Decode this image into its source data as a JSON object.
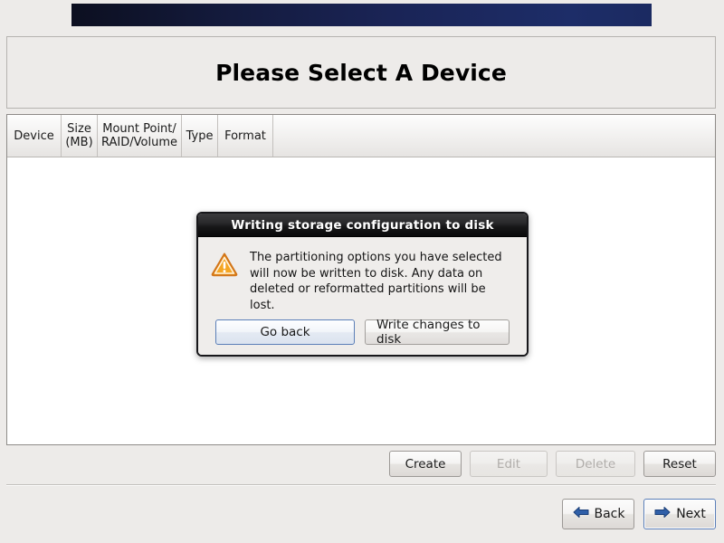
{
  "banner": {
    "gradient_start": "#0c0f20",
    "gradient_end": "#1d2d68"
  },
  "header": {
    "title": "Please Select A Device"
  },
  "device_table": {
    "columns": [
      {
        "label": "Device"
      },
      {
        "label": "Size\n(MB)"
      },
      {
        "label": "Mount Point/\nRAID/Volume"
      },
      {
        "label": "Type"
      },
      {
        "label": "Format"
      },
      {
        "label": ""
      }
    ],
    "rows": []
  },
  "actions": {
    "create": {
      "label": "Create",
      "enabled": true
    },
    "edit": {
      "label": "Edit",
      "enabled": false
    },
    "delete": {
      "label": "Delete",
      "enabled": false
    },
    "reset": {
      "label": "Reset",
      "enabled": true
    }
  },
  "navigation": {
    "back": {
      "label": "Back",
      "icon": "arrow-left-icon"
    },
    "next": {
      "label": "Next",
      "icon": "arrow-right-icon",
      "focused": true
    }
  },
  "dialog": {
    "title": "Writing storage configuration to disk",
    "icon": "warning-triangle-icon",
    "message": "The partitioning options you have selected\nwill now be written to disk.  Any data on\ndeleted or reformatted partitions will be lost.",
    "buttons": {
      "go_back": {
        "label": "Go back",
        "focused": true
      },
      "write_changes": {
        "label": "Write changes to disk",
        "focused": false
      }
    },
    "accent_color": "#5b7fb8",
    "warning_color": "#f0932b"
  }
}
